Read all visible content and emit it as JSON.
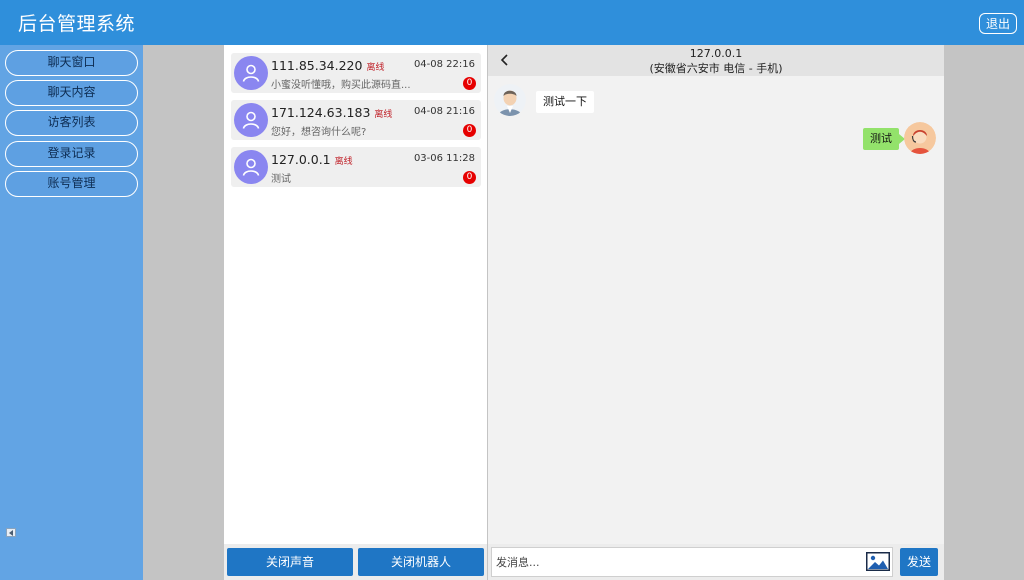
{
  "header": {
    "title": "后台管理系统",
    "logout_label": "退出"
  },
  "sidebar": {
    "items": [
      {
        "label": "聊天窗口"
      },
      {
        "label": "聊天内容"
      },
      {
        "label": "访客列表"
      },
      {
        "label": "登录记录"
      },
      {
        "label": "账号管理"
      }
    ]
  },
  "conversations": [
    {
      "ip": "111.85.34.220",
      "status": "离线",
      "time": "04-08 22:16",
      "last_message": "小蜜没听懂哦，购买此源码直...",
      "unread": "0"
    },
    {
      "ip": "171.124.63.183",
      "status": "离线",
      "time": "04-08 21:16",
      "last_message": "您好，想咨询什么呢?",
      "unread": "0"
    },
    {
      "ip": "127.0.0.1",
      "status": "离线",
      "time": "03-06 11:28",
      "last_message": "测试",
      "unread": "0"
    }
  ],
  "list_footer": {
    "mute_label": "关闭声音",
    "robot_label": "关闭机器人"
  },
  "chat": {
    "ip": "127.0.0.1",
    "location": "(安徽省六安市 电信 - 手机)",
    "messages": [
      {
        "from": "visitor",
        "text": "测试一下"
      },
      {
        "from": "agent",
        "text": "测试"
      }
    ],
    "input_placeholder": "发消息...",
    "send_label": "发送"
  },
  "colors": {
    "header": "#2f8fdb",
    "sidebar": "#62a4e4",
    "button": "#1f76c5",
    "avatar": "#8a86f0",
    "agent_bubble": "#93e26b",
    "badge": "#e60000"
  }
}
